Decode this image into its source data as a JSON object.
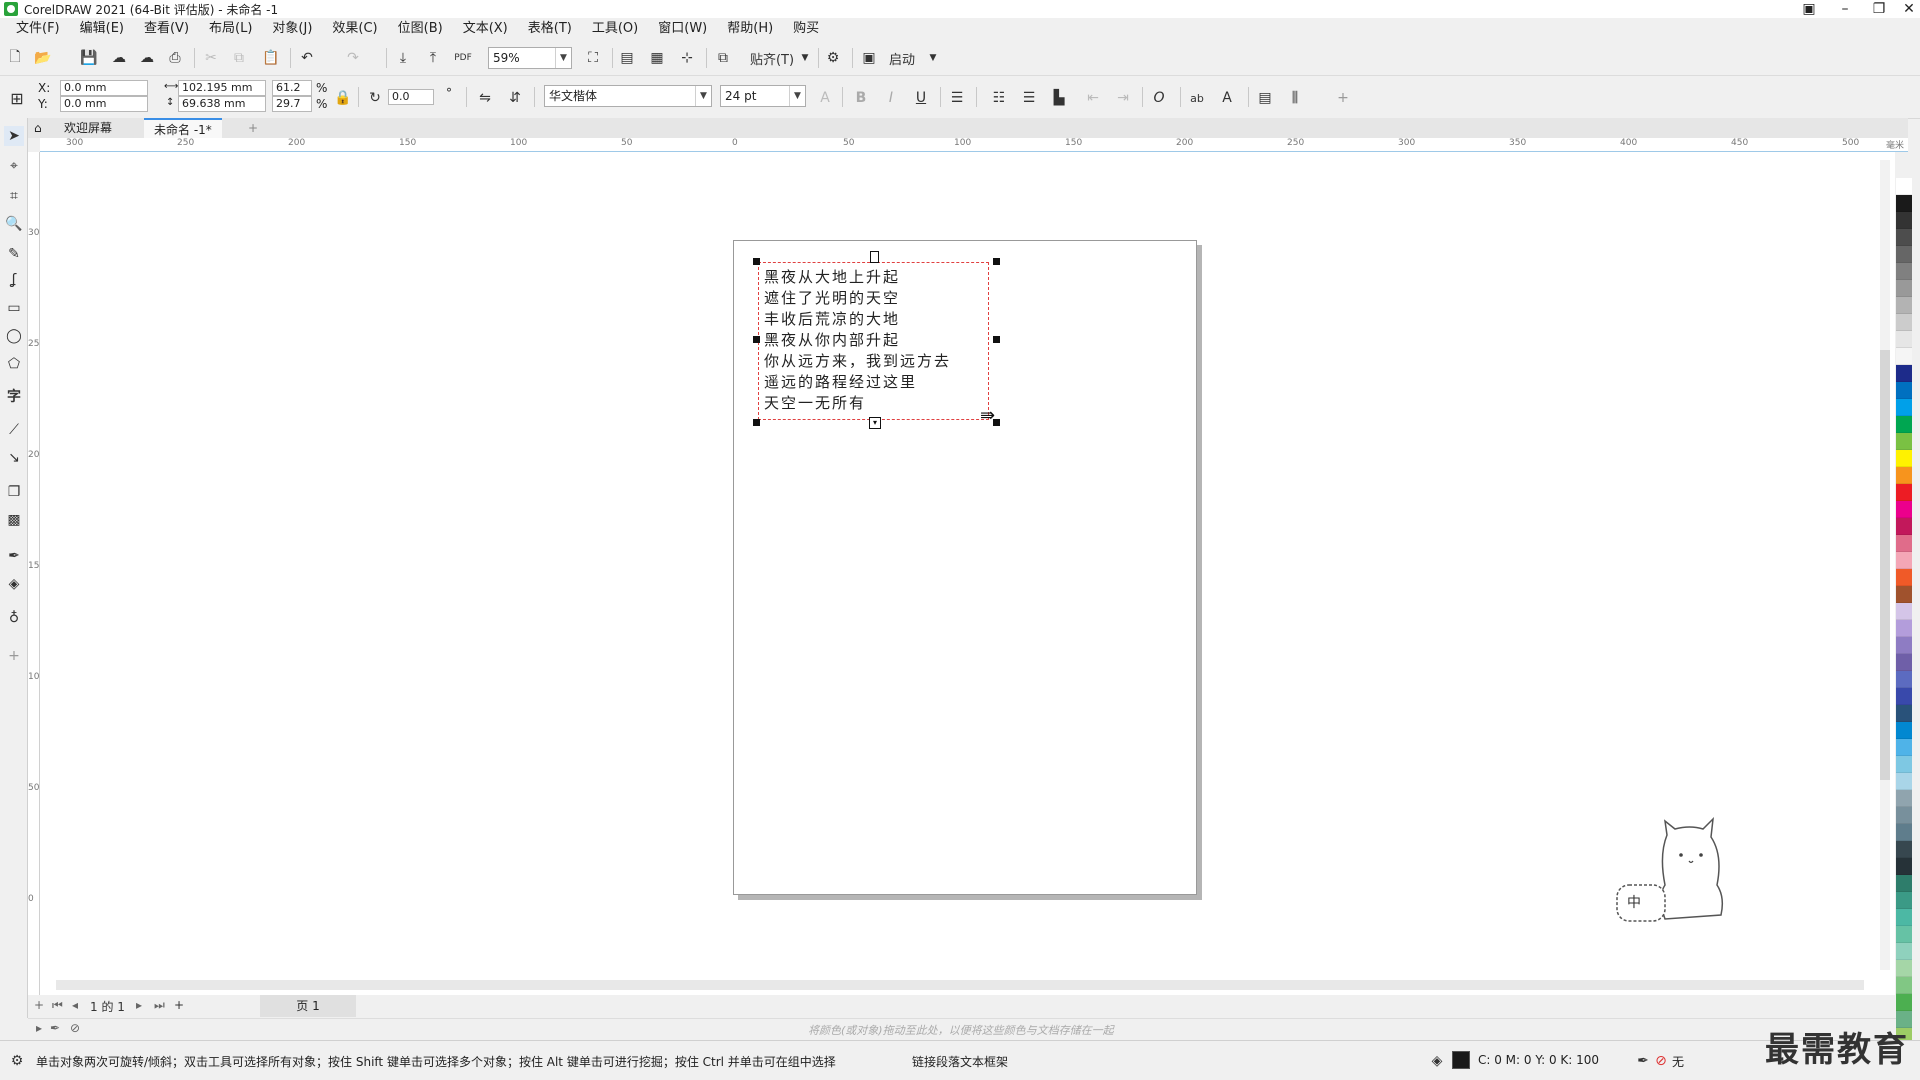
{
  "window": {
    "title": "CorelDRAW 2021 (64-Bit 评估版) - 未命名 -1"
  },
  "menu": [
    "文件(F)",
    "编辑(E)",
    "查看(V)",
    "布局(L)",
    "对象(J)",
    "效果(C)",
    "位图(B)",
    "文本(X)",
    "表格(T)",
    "工具(O)",
    "窗口(W)",
    "帮助(H)",
    "购买"
  ],
  "toolbar": {
    "zoom": "59%",
    "snap_label": "贴齐(T)",
    "launch_label": "启动"
  },
  "propbar": {
    "x_label": "X:",
    "x_value": "0.0 mm",
    "y_label": "Y:",
    "y_value": "0.0 mm",
    "width_value": "102.195 mm",
    "height_value": "69.638 mm",
    "scale_x": "61.2",
    "scale_y": "29.7",
    "percent": "%",
    "rotation": "0.0",
    "degree": "°",
    "font_name": "华文楷体",
    "font_size": "24 pt"
  },
  "tabs": {
    "welcome": "欢迎屏幕",
    "document": "未命名 -1*"
  },
  "ruler": {
    "h_ticks": [
      "300",
      "250",
      "200",
      "150",
      "100",
      "50",
      "0",
      "50",
      "100",
      "150",
      "200",
      "250",
      "300",
      "350",
      "400",
      "450",
      "500"
    ],
    "unit": "毫米",
    "v_ticks": [
      "300",
      "250",
      "200",
      "150",
      "100",
      "50",
      "0"
    ]
  },
  "poem": {
    "lines": [
      "黑夜从大地上升起",
      "遮住了光明的天空",
      "丰收后荒凉的大地",
      "黑夜从你内部升起",
      "你从远方来，我到远方去",
      "遥远的路程经过这里",
      "天空一无所有"
    ]
  },
  "pagenav": {
    "page_count": "1 的 1",
    "page_tab": "页 1"
  },
  "colordock": {
    "hint": "将颜色(或对象)拖动至此处，以便将这些颜色与文档存储在一起"
  },
  "status": {
    "message": "单击对象两次可旋转/倾斜；双击工具可选择所有对象；按住 Shift 键单击可选择多个对象；按住 Alt 键单击可进行挖掘；按住 Ctrl 并单击可在组中选择",
    "link_text": "链接段落文本框架",
    "cmyk": "C: 0 M: 0 Y: 0 K: 100",
    "outline": "无"
  },
  "mascot": {
    "sign_text": "中"
  },
  "watermark": "最需教育",
  "palette": [
    "#ffffff",
    "#1a1a1a",
    "#333333",
    "#4d4d4d",
    "#666666",
    "#808080",
    "#999999",
    "#b3b3b3",
    "#cccccc",
    "#e6e6e6",
    "#f5f5f5",
    "#1d2b8a",
    "#0070c0",
    "#00a0e9",
    "#00a651",
    "#7ac143",
    "#fff200",
    "#f7941d",
    "#ed1c24",
    "#ec008c",
    "#c2185b",
    "#e06c8a",
    "#f4a6b6",
    "#f05a28",
    "#a0522d",
    "#d4c5e8",
    "#b39ddb",
    "#8e7cc3",
    "#6f5fa8",
    "#5c6bc0",
    "#3949ab",
    "#29527a",
    "#0288d1",
    "#4fb3e8",
    "#7ec8e3",
    "#a9d5e8",
    "#90a4ae",
    "#78909c",
    "#5f7d8c",
    "#37474f",
    "#263238",
    "#2e7d6b",
    "#3b9a86",
    "#4cb8a4",
    "#66c2a5",
    "#8fd1bd",
    "#a5d6a7",
    "#81c784",
    "#4caf50",
    "#6ab187",
    "#9ccc65",
    "#b2dfdb"
  ]
}
